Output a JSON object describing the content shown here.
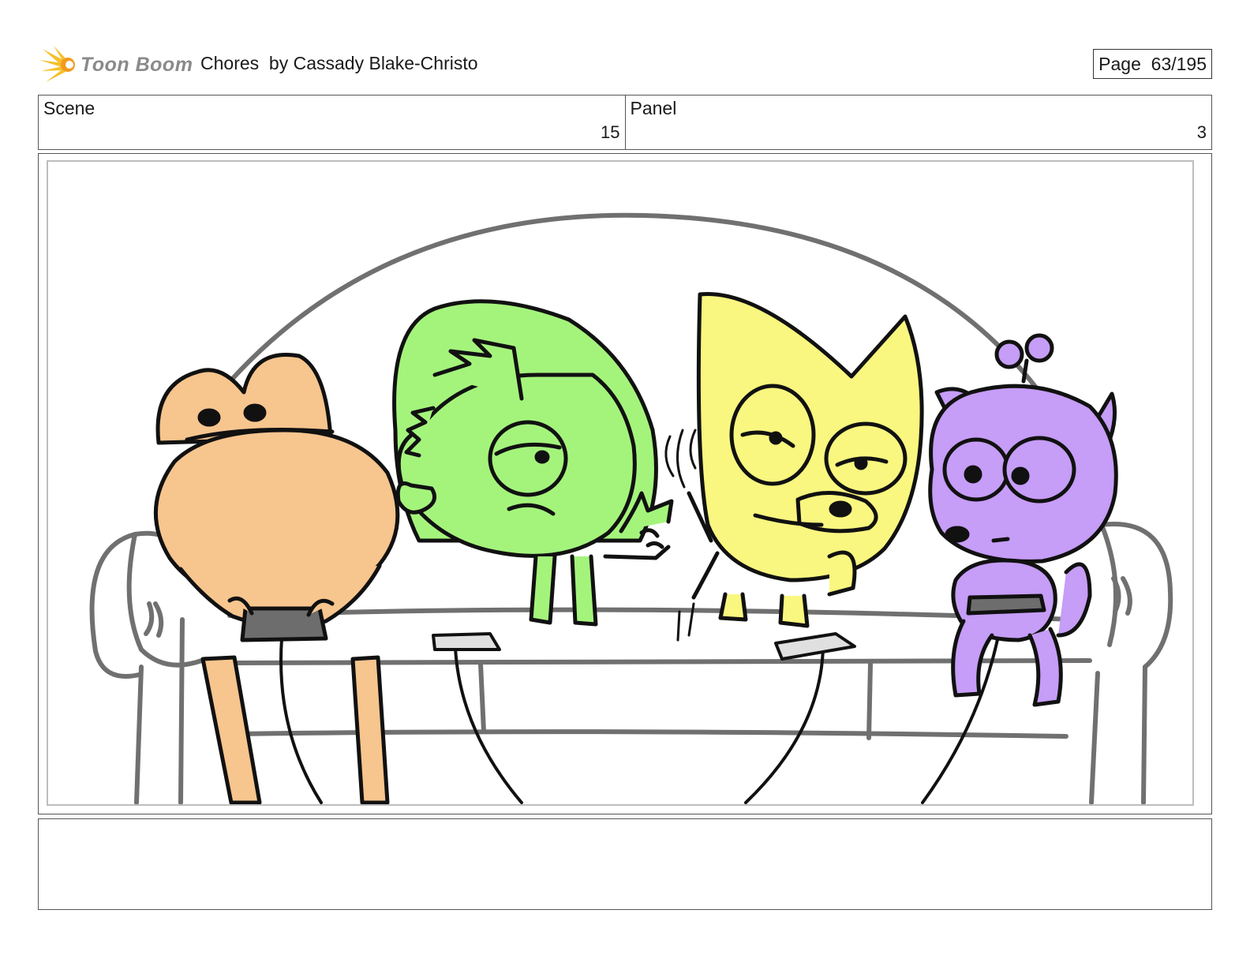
{
  "header": {
    "logo_text": "Toon Boom",
    "title": "Chores  by Cassady Blake-Christo",
    "page": "Page  63/195"
  },
  "scene": {
    "label": "Scene",
    "value": "15"
  },
  "panel": {
    "label": "Panel",
    "value": "3"
  },
  "notes": {
    "text": ""
  },
  "artwork": {
    "icons": [
      "toon-boom-logo-icon"
    ],
    "characters": [
      {
        "name": "orange-frog",
        "color": "#F7C58E"
      },
      {
        "name": "green-fish",
        "color": "#A4F47C"
      },
      {
        "name": "yellow-cat",
        "color": "#F9F77F"
      },
      {
        "name": "purple-squirrel",
        "color": "#C69DF7"
      }
    ],
    "couch_color": "#707070",
    "line_color": "#111111"
  }
}
